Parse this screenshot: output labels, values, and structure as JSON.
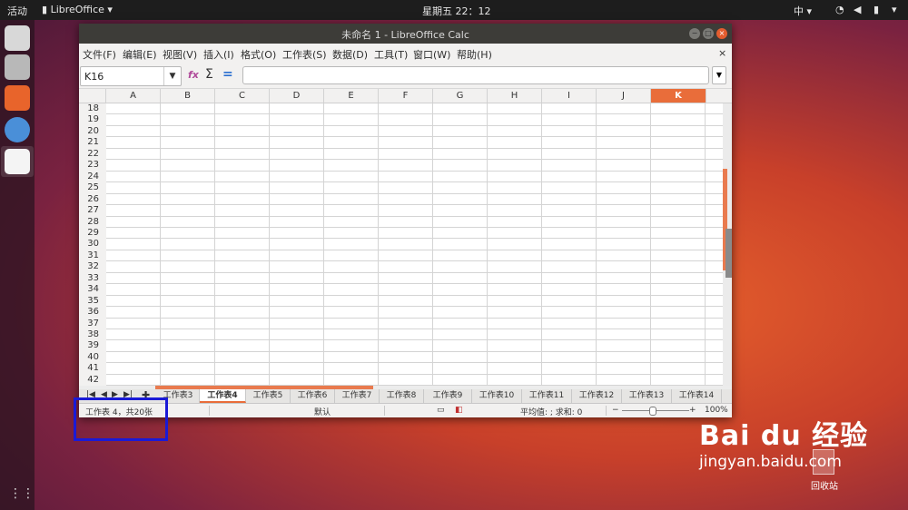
{
  "topbar": {
    "activities": "活动",
    "app_name": "LibreOffice",
    "clock": "星期五 22：12",
    "input_method": "中"
  },
  "window": {
    "title": "未命名 1 - LibreOffice Calc",
    "menus": [
      "文件(F)",
      "编辑(E)",
      "视图(V)",
      "插入(I)",
      "格式(O)",
      "工作表(S)",
      "数据(D)",
      "工具(T)",
      "窗口(W)",
      "帮助(H)"
    ],
    "close_doc": "×"
  },
  "formula": {
    "cell_ref": "K16",
    "fx_label": "fx",
    "sum_label": "Σ",
    "eq_label": "="
  },
  "columns": [
    "A",
    "B",
    "C",
    "D",
    "E",
    "F",
    "G",
    "H",
    "I",
    "J",
    "K"
  ],
  "selected_column": "K",
  "rows": [
    "18",
    "19",
    "20",
    "21",
    "22",
    "23",
    "24",
    "25",
    "26",
    "27",
    "28",
    "29",
    "30",
    "31",
    "32",
    "33",
    "34",
    "35",
    "36",
    "37",
    "38",
    "39",
    "40",
    "41",
    "42"
  ],
  "sheet_tabs": [
    "工作表3",
    "工作表4",
    "工作表5",
    "工作表6",
    "工作表7",
    "工作表8",
    "工作表9",
    "工作表10",
    "工作表11",
    "工作表12",
    "工作表13",
    "工作表14"
  ],
  "active_tab": "工作表4",
  "status": {
    "sheet_info": "工作表 4，共20张",
    "style": "默认",
    "summary": "平均值: ; 求和: 0",
    "zoom": "100%",
    "zoom_minus": "−",
    "zoom_plus": "+"
  },
  "desktop": {
    "trash_label": "回收站",
    "watermark_brand": "Bai du 经验",
    "watermark_url": "jingyan.baidu.com"
  },
  "colors": {
    "accent": "#e96d3a",
    "highlight_box": "#1a1ad6",
    "titlebar": "#3d3c38"
  }
}
